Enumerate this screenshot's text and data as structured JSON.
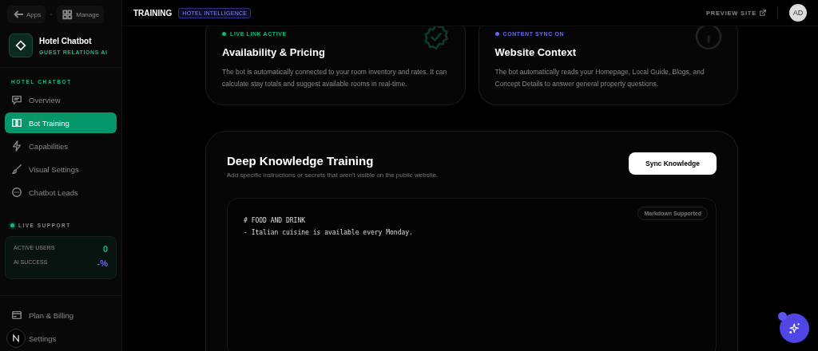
{
  "sidebar": {
    "top_links": [
      {
        "kind": "back",
        "label": "Apps"
      },
      {
        "kind": "grid",
        "label": "Manage"
      }
    ],
    "app": {
      "name": "Hotel Chatbot",
      "subtitle": "GUEST RELATIONS AI"
    },
    "section_title": "HOTEL CHATBOT",
    "items": [
      {
        "label": "Overview",
        "selected": false
      },
      {
        "label": "Bot Training",
        "selected": true
      },
      {
        "label": "Capabilities",
        "selected": false
      },
      {
        "label": "Visual Settings",
        "selected": false
      },
      {
        "label": "Chatbot Leads",
        "selected": false
      }
    ],
    "live_support": {
      "title": "LIVE SUPPORT",
      "stats": [
        {
          "label": "ACTIVE USERS",
          "value": "0",
          "color": "#10b981"
        },
        {
          "label": "AI SUCCESS",
          "value": "-%",
          "color": "#6366f1"
        }
      ]
    },
    "bottom_items": [
      {
        "label": "Plan & Billing"
      },
      {
        "label": "Settings"
      }
    ]
  },
  "header": {
    "title": "TRAINING",
    "badge": "HOTEL INTELLIGENCE",
    "preview": "PREVIEW SITE",
    "avatar": "AD"
  },
  "cards": [
    {
      "status": "LIVE LINK ACTIVE",
      "color": "#10b981",
      "title": "Availability & Pricing",
      "text": "The bot is automatically connected to your room inventory and rates. It can calculate stay totals and suggest available rooms in real-time."
    },
    {
      "status": "CONTENT SYNC ON",
      "color": "#6366f1",
      "title": "Website Context",
      "text": "The bot automatically reads your Homepage, Local Guide, Blogs, and Concept Details to answer general property questions."
    }
  ],
  "training": {
    "title": "Deep Knowledge Training",
    "subtitle": "Add specific instructions or secrets that aren't visible on the public website.",
    "button": "Sync Knowledge",
    "editor_badge": "Markdown Supported",
    "editor_value": "# FOOD AND DRINK\n- Italian cuisine is available every Monday."
  }
}
